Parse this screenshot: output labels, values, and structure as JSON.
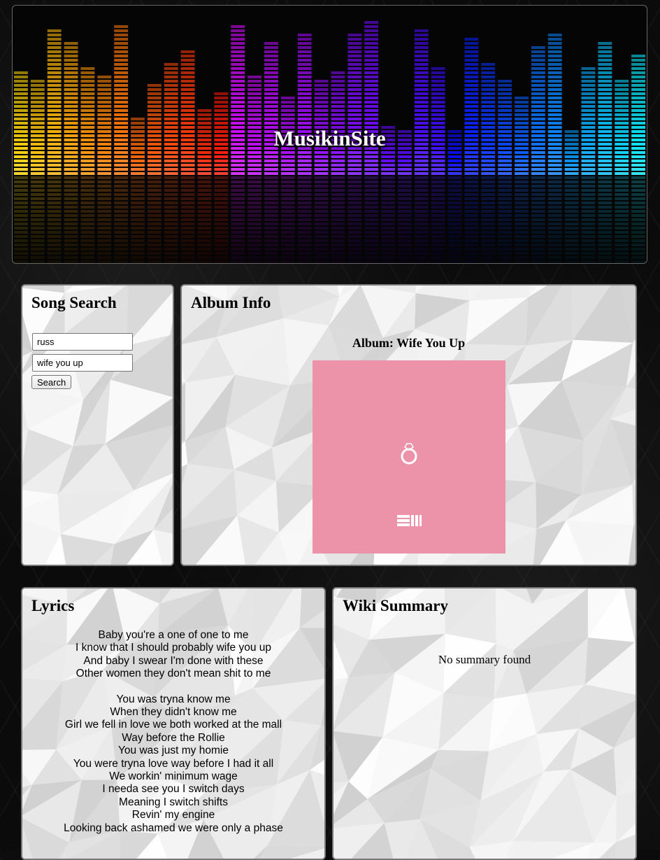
{
  "site": {
    "title": "MusikinSite"
  },
  "search": {
    "heading": "Song Search",
    "artist_value": "russ",
    "song_value": "wife you up",
    "button_label": "Search"
  },
  "album": {
    "heading": "Album Info",
    "title": "Album: Wife You Up",
    "cover_color": "#ec93a9"
  },
  "lyrics": {
    "heading": "Lyrics",
    "stanzas": [
      [
        "Baby you're a one of one to me",
        "I know that I should probably wife you up",
        "And baby I swear I'm done with these",
        "Other women they don't mean shit to me"
      ],
      [
        "You was tryna know me",
        "When they didn't know me",
        "Girl we fell in love we both worked at the mall",
        "Way before the Rollie",
        "You was just my homie",
        "You were tryna love way before I had it all",
        "We workin' minimum wage",
        "I needa see you I switch days",
        "Meaning I switch shifts",
        "Revin' my engine",
        "Looking back ashamed we were only a phase"
      ]
    ]
  },
  "wiki": {
    "heading": "Wiki Summary",
    "text": "No summary found"
  }
}
